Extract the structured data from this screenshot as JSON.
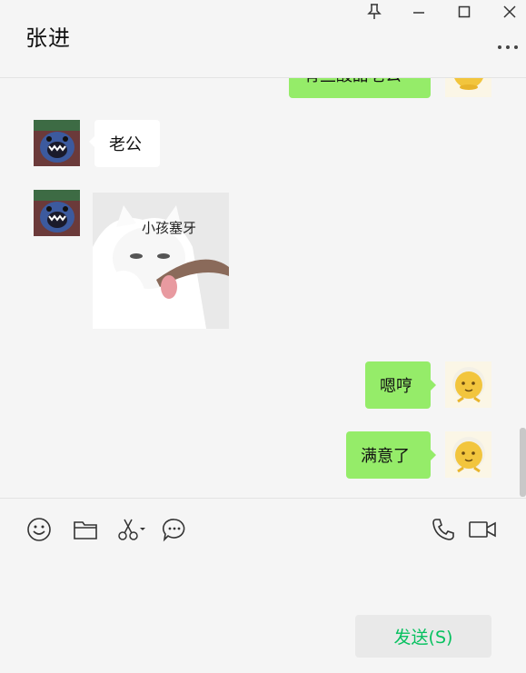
{
  "window": {
    "title": "张进"
  },
  "messages": [
    {
      "side": "right",
      "type": "text",
      "text": "有些酸甜老公"
    },
    {
      "side": "left",
      "type": "text",
      "text": "老公"
    },
    {
      "side": "left",
      "type": "sticker",
      "caption": "小孩塞牙"
    },
    {
      "side": "right",
      "type": "text",
      "text": "嗯哼"
    },
    {
      "side": "right",
      "type": "text",
      "text": "满意了"
    }
  ],
  "toolbar": {
    "icons": [
      "emoji-icon",
      "folder-icon",
      "scissors-icon",
      "chat-bubble-icon",
      "phone-icon",
      "video-icon"
    ]
  },
  "input": {
    "value": ""
  },
  "send_button": {
    "label": "发送(S)"
  },
  "colors": {
    "accent": "#07c160",
    "bubble_right": "#95ec69",
    "bubble_left": "#ffffff",
    "background": "#f5f5f5"
  }
}
